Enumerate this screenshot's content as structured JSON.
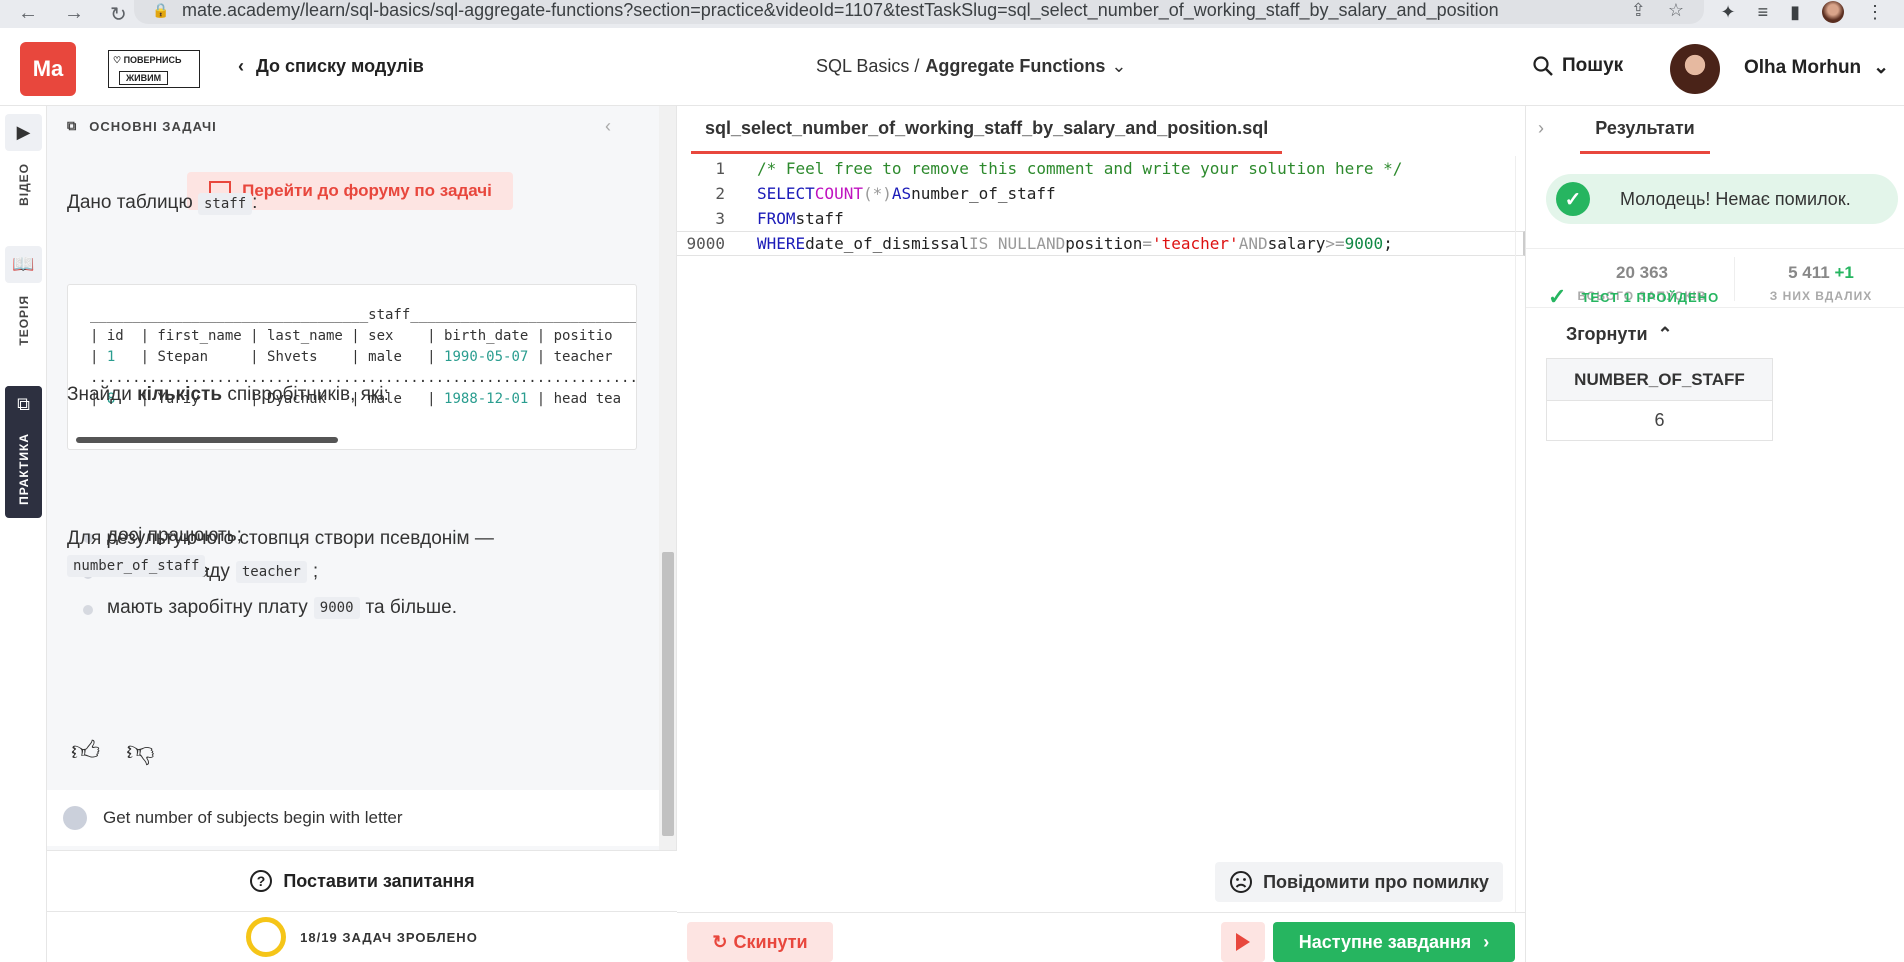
{
  "browser": {
    "url": "mate.academy/learn/sql-basics/sql-aggregate-functions?section=practice&videoId=1107&testTaskSlug=sql_select_number_of_working_staff_by_salary_and_position"
  },
  "header": {
    "logo": "Ma",
    "badge_line1": "ПОВЕРНИСЬ",
    "badge_line2": "ЖИВИМ",
    "back_label": "До списку модулів",
    "course": "SQL Basics /",
    "module": "Aggregate Functions",
    "search_label": "Пошук",
    "user_name": "Olha Morhun"
  },
  "rail": {
    "video": "ВІДЕО",
    "theory": "ТЕОРІЯ",
    "practice": "ПРАКТИКА"
  },
  "task": {
    "section_title": "ОСНОВНІ ЗАДАЧІ",
    "forum_button": "Перейти до форуму по задачі",
    "given_prefix": "Дано таблицю",
    "given_table": "staff",
    "given_suffix": ":",
    "table_text": {
      "title_line": "_________________________________staff_______________________________",
      "header_row": "| id  | first_name | last_name | sex    | birth_date | positio",
      "row1_a": "| ",
      "row1_id": "1",
      "row1_b": "   | Stepan     | Shvets    | male   | ",
      "row1_date": "1990-05-07",
      "row1_c": " | teacher",
      "dots": ".....................................................................",
      "row8_a": "| ",
      "row8_id": "8",
      "row8_b": "   | Yuriy      | Dyachuk   | male   | ",
      "row8_date": "1988-12-01",
      "row8_c": " | head tea"
    },
    "find_prefix": "Знайди",
    "find_bold": "кількість",
    "find_suffix": "співробітників, які:",
    "bullets": [
      {
        "text": "досі працюють;",
        "code": "",
        "after": ""
      },
      {
        "text": "мають посаду",
        "code": "teacher",
        "after": ";"
      },
      {
        "text": "мають заробітну плату",
        "code": "9000",
        "after": "та більше."
      }
    ],
    "alias_text": "Для результуючого стовпця створи псевдонім —",
    "alias_code": "number_of_staff",
    "alias_after": ".",
    "next_task": "Get number of subjects begin with letter",
    "ask_question": "Поставити запитання",
    "progress": "18/19 ЗАДАЧ ЗРОБЛЕНО"
  },
  "editor": {
    "filename": "sql_select_number_of_working_staff_by_salary_and_position.sql",
    "lines": {
      "l1_num": "1",
      "l2_num": "2",
      "l3_num": "3",
      "l4_num": "9000",
      "l1_comment": "/* Feel free to remove this comment and write your solution here */",
      "l2_select": "SELECT",
      "l2_count": "COUNT",
      "l2_args": "(*)",
      "l2_as": "AS",
      "l2_alias": "number_of_staff",
      "l3_from": "FROM",
      "l3_table": "staff",
      "l4_where": "WHERE",
      "l4_col1": "date_of_dismissal",
      "l4_isnull": "IS NULL",
      "l4_and1": "AND",
      "l4_col2": "position",
      "l4_eq": "=",
      "l4_str": "'teacher'",
      "l4_and2": "AND",
      "l4_col3": "salary",
      "l4_ge": ">=",
      "l4_semi": ";"
    },
    "report_button": "Повідомити про помилку",
    "reset_button": "Скинути",
    "next_button": "Наступне завдання"
  },
  "results": {
    "tab": "Результати",
    "success_msg": "Молодець! Немає помилок.",
    "total_runs": "20 363",
    "total_runs_label": "ВСЬОГО ЗАПУСКІВ",
    "successful": "5 411",
    "successful_plus": "+1",
    "successful_label": "З НИХ ВДАЛИХ",
    "test_passed": "ТЕСТ 1 ПРОЙДЕНО",
    "collapse": "Згорнути",
    "column": "NUMBER_OF_STAFF",
    "value": "6"
  },
  "colors": {
    "brand": "#e8473d",
    "success": "#26b560",
    "rail_active": "#2d3040"
  }
}
